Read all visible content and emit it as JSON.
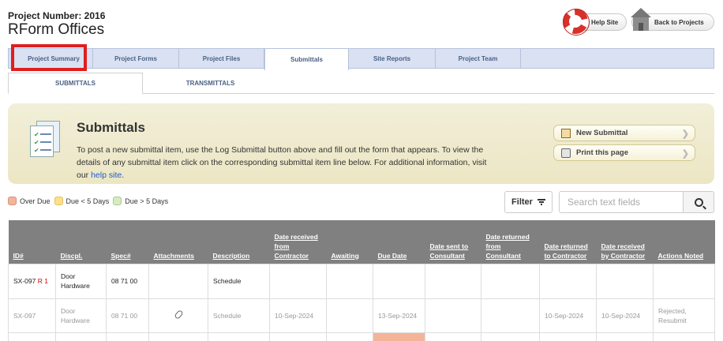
{
  "project": {
    "number_label": "Project Number: 2016",
    "name": "RForm Offices"
  },
  "header_buttons": {
    "help": "Help Site",
    "back": "Back to Projects"
  },
  "tabs": [
    {
      "label": "Project Summary"
    },
    {
      "label": "Project Forms"
    },
    {
      "label": "Project Files"
    },
    {
      "label": "Submittals"
    },
    {
      "label": "Site Reports"
    },
    {
      "label": "Project Team"
    }
  ],
  "subtabs": [
    {
      "label": "SUBMITTALS"
    },
    {
      "label": "TRANSMITTALS"
    }
  ],
  "banner": {
    "title": "Submittals",
    "text": "To post a new submittal item, use the Log Submittal button above and fill out the form that appears. To view the details of any submittal item click on the corresponding submittal item line below. For additional information, visit our ",
    "link": "help site",
    "text_end": ".",
    "new_button": "New Submittal",
    "print_button": "Print this page"
  },
  "legend": [
    {
      "label": "Over Due",
      "color": "#f4b49a"
    },
    {
      "label": "Due < 5 Days",
      "color": "#ffe08a"
    },
    {
      "label": "Due > 5 Days",
      "color": "#d6ecc0"
    }
  ],
  "filter": {
    "label": "Filter"
  },
  "search": {
    "placeholder": "Search text fields"
  },
  "table": {
    "headers": [
      "ID#",
      "Discpl.",
      "Spec#",
      "Attachments",
      "Description",
      "Date received from Contractor",
      "Awaiting",
      "Due Date",
      "Date sent to Consultant",
      "Date returned from Consultant",
      "Date returned to Contractor",
      "Date received by Contractor",
      "Actions Noted"
    ],
    "rows": [
      {
        "id": "SX-097",
        "rev": "R 1",
        "discipline": "Door Hardware",
        "spec": "08 71 00",
        "attachment": "",
        "description": "Schedule",
        "received": "",
        "awaiting": "",
        "due": "",
        "sent": "",
        "returned_from": "",
        "returned_to": "",
        "received_by": "",
        "actions": ""
      },
      {
        "id": "SX-097",
        "rev": "",
        "discipline": "Door Hardware",
        "spec": "08 71 00",
        "attachment": "paperclip-icon",
        "description": "Schedule",
        "received": "10-Sep-2024",
        "awaiting": "",
        "due": "13-Sep-2024",
        "sent": "",
        "returned_from": "",
        "returned_to": "10-Sep-2024",
        "received_by": "10-Sep-2024",
        "actions": "Rejected, Resubmit"
      }
    ]
  }
}
